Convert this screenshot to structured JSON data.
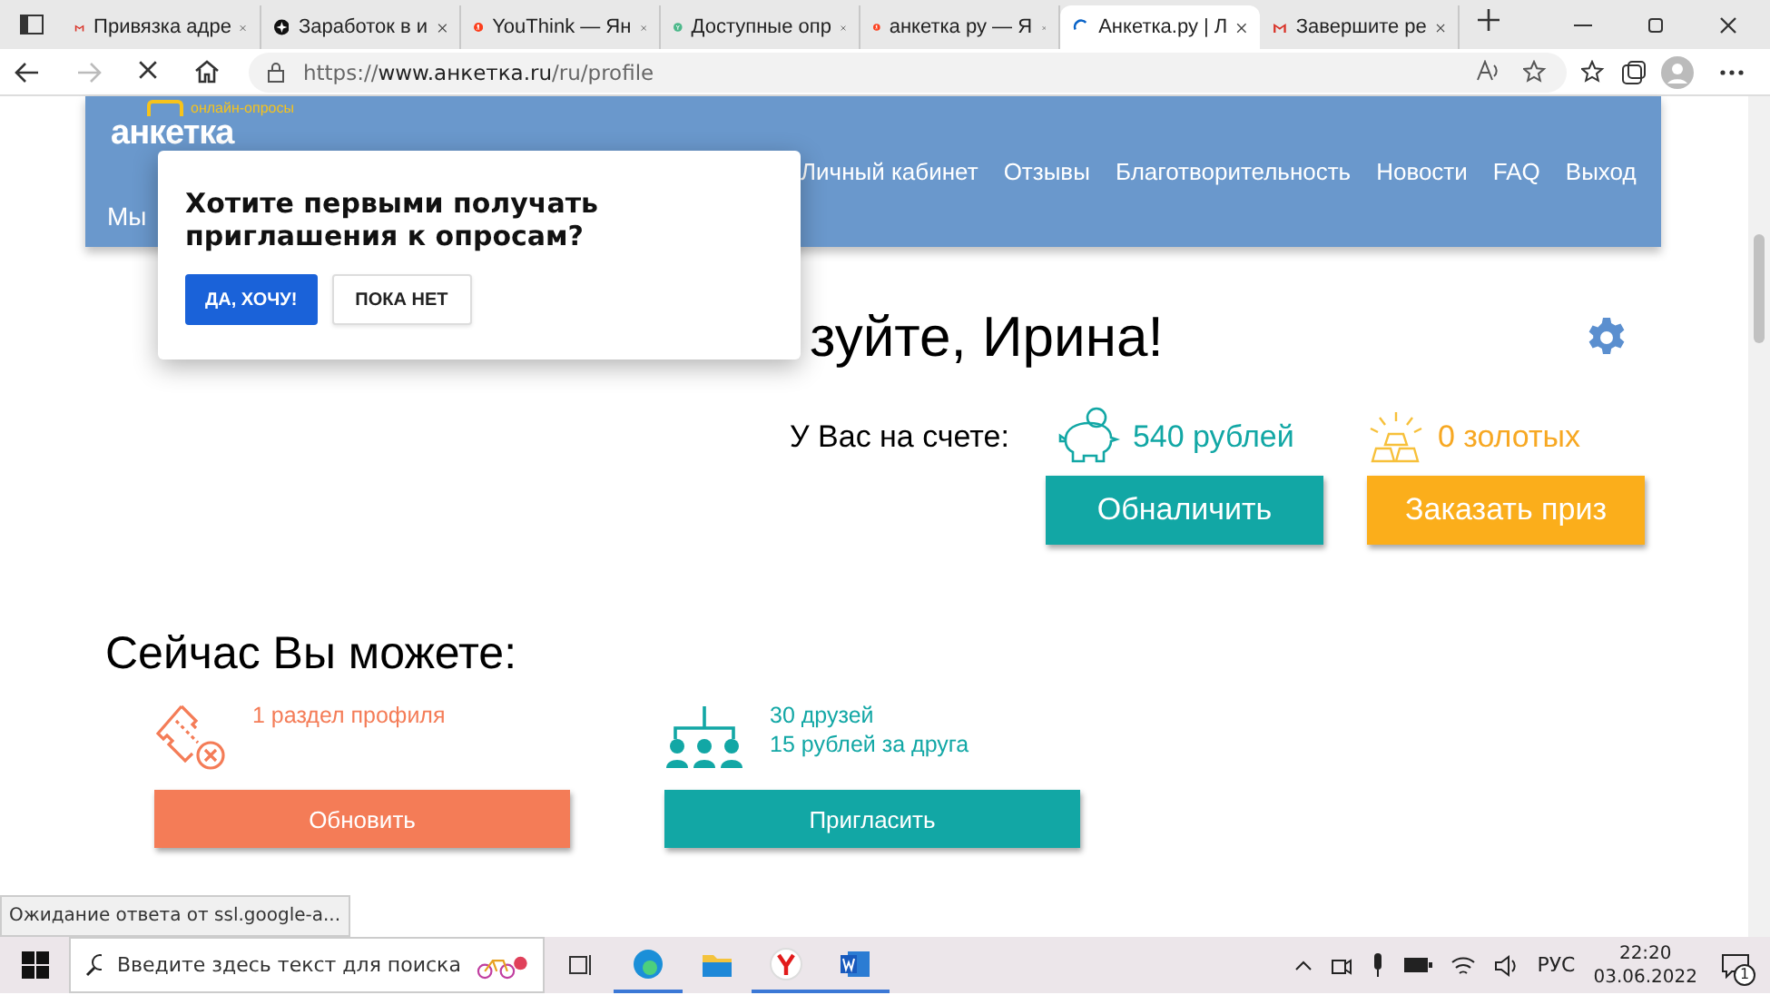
{
  "browser": {
    "tabs": [
      {
        "title": "Привязка адре",
        "selected": false
      },
      {
        "title": "Заработок в и",
        "selected": false
      },
      {
        "title": "YouThink — Ян",
        "selected": false
      },
      {
        "title": "Доступные опр",
        "selected": false
      },
      {
        "title": "анкетка ру — Я",
        "selected": false
      },
      {
        "title": "Анкетка.ру | Л",
        "selected": true
      },
      {
        "title": "Завершите ре",
        "selected": false
      }
    ],
    "address": {
      "host": "https://www.анкетка.ru",
      "path": "/ru/profile"
    },
    "status_text": "Ожидание ответа от ssl.google-a..."
  },
  "site": {
    "logo_tagline": "онлайн-опросы",
    "logo_word": "анкетка",
    "subtitle": "Мы",
    "nav": [
      "Личный кабинет",
      "Отзывы",
      "Благотворительность",
      "Новости",
      "FAQ",
      "Выход"
    ],
    "greeting": "зуйте, Ирина!",
    "balance_label": "У Вас на счете:",
    "rubles": "540 рублей",
    "gold": "0 золотых",
    "cash_button": "Обналичить",
    "prize_button": "Заказать приз",
    "now_title": "Сейчас Вы можете:",
    "actions": [
      {
        "kind": "profile",
        "lines": [
          "1 раздел профиля"
        ],
        "button": "Обновить"
      },
      {
        "kind": "friends",
        "lines": [
          "30 друзей",
          "15 рублей за друга"
        ],
        "button": "Пригласить"
      }
    ]
  },
  "popup": {
    "question": "Хотите первыми получать приглашения к опросам?",
    "accept": "ДА, ХОЧУ!",
    "decline": "ПОКА НЕТ"
  },
  "taskbar": {
    "search_placeholder": "Введите здесь текст для поиска",
    "language": "РУС",
    "time": "22:20",
    "date": "03.06.2022",
    "notifications": "1"
  }
}
